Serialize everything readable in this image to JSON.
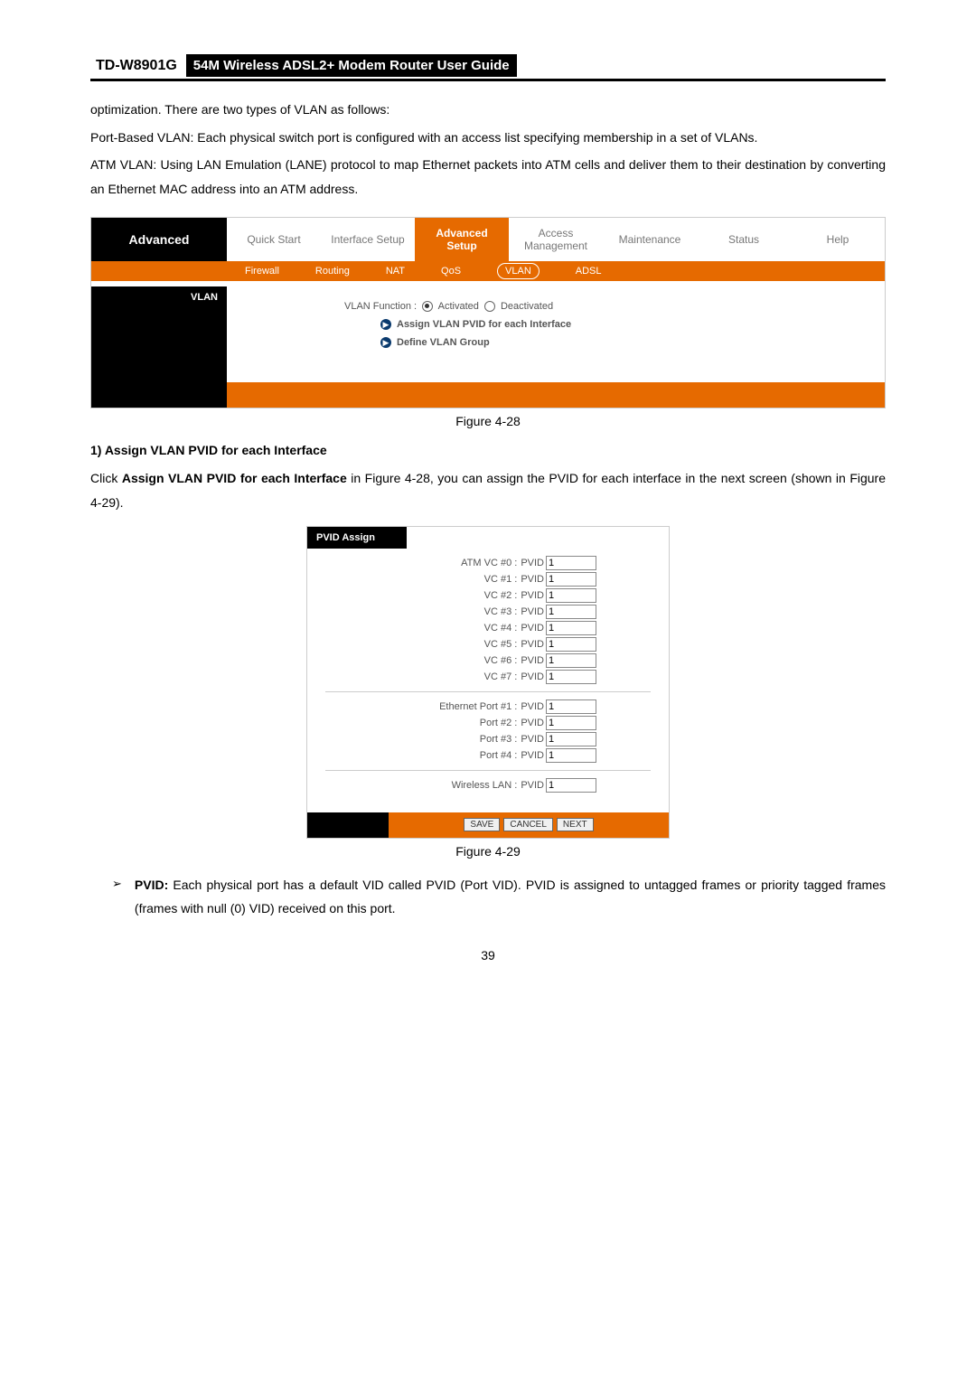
{
  "header": {
    "model": "TD-W8901G",
    "title": "54M Wireless ADSL2+ Modem Router User Guide"
  },
  "paragraphs": {
    "p1": "optimization. There are two types of VLAN as follows:",
    "p2": "Port-Based VLAN: Each physical switch port is configured with an access list specifying membership in a set of VLANs.",
    "p3": "ATM VLAN: Using LAN Emulation (LANE) protocol to map Ethernet packets into ATM cells and deliver them to their destination by converting an Ethernet MAC address into an ATM address."
  },
  "fig1": {
    "title": "Advanced",
    "tabs": {
      "t1": "Quick Start",
      "t2": "Interface Setup",
      "t3": "Advanced Setup",
      "t4": "Access Management",
      "t5": "Maintenance",
      "t6": "Status",
      "t7": "Help"
    },
    "subtabs": {
      "s1": "Firewall",
      "s2": "Routing",
      "s3": "NAT",
      "s4": "QoS",
      "s5": "VLAN",
      "s6": "ADSL"
    },
    "section_label": "VLAN",
    "vlan_function_label": "VLAN Function :",
    "activated": "Activated",
    "deactivated": "Deactivated",
    "link1": "Assign VLAN PVID for each Interface",
    "link2": "Define VLAN Group"
  },
  "captions": {
    "fig428": "Figure 4-28",
    "fig429": "Figure 4-29"
  },
  "section1": {
    "heading": "1)   Assign VLAN PVID for each Interface",
    "body_pre": "Click ",
    "body_bold": "Assign VLAN PVID for each Interface",
    "body_post": " in Figure 4-28, you can assign the PVID for each interface in the next screen (shown in Figure 4-29)."
  },
  "fig2": {
    "header": "PVID Assign",
    "label_pvid": "PVID",
    "rows": [
      {
        "label": "ATM VC #0 :",
        "value": "1"
      },
      {
        "label": "VC #1 :",
        "value": "1"
      },
      {
        "label": "VC #2 :",
        "value": "1"
      },
      {
        "label": "VC #3 :",
        "value": "1"
      },
      {
        "label": "VC #4 :",
        "value": "1"
      },
      {
        "label": "VC #5 :",
        "value": "1"
      },
      {
        "label": "VC #6 :",
        "value": "1"
      },
      {
        "label": "VC #7 :",
        "value": "1"
      }
    ],
    "eth_rows": [
      {
        "label": "Ethernet Port #1 :",
        "value": "1"
      },
      {
        "label": "Port #2 :",
        "value": "1"
      },
      {
        "label": "Port #3 :",
        "value": "1"
      },
      {
        "label": "Port #4 :",
        "value": "1"
      }
    ],
    "wlan": {
      "label": "Wireless LAN :",
      "value": "1"
    },
    "buttons": {
      "save": "SAVE",
      "cancel": "CANCEL",
      "next": "NEXT"
    }
  },
  "bullet": {
    "label": "PVID:",
    "text": " Each physical port has a default VID called PVID (Port VID). PVID is assigned to untagged frames or priority tagged frames (frames with null (0) VID) received on this port."
  },
  "page_number": "39"
}
